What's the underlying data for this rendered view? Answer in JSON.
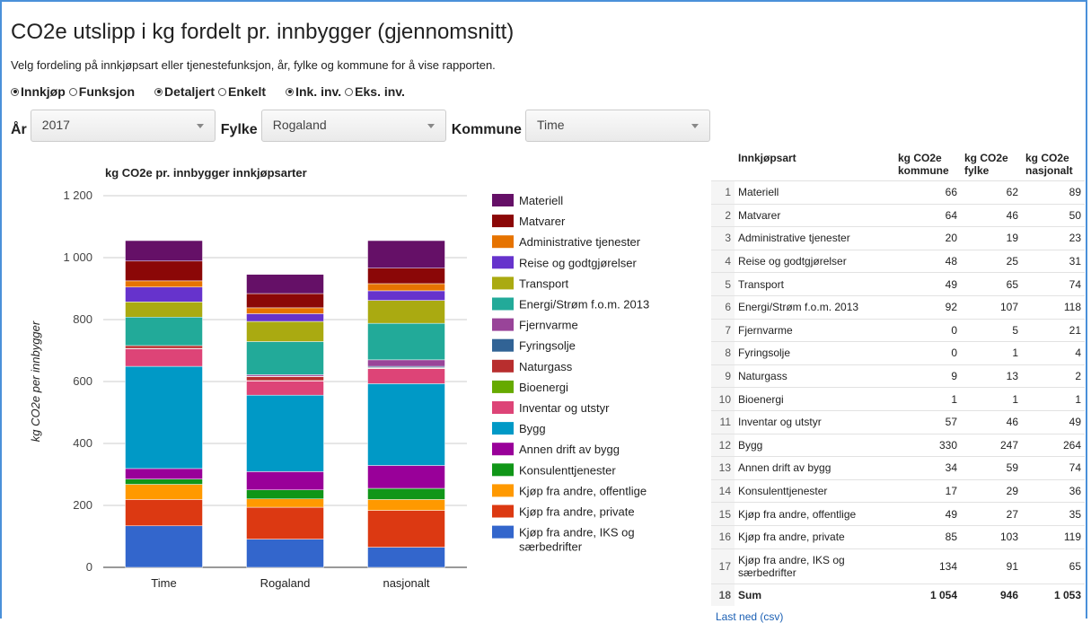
{
  "header": {
    "title": "CO2e utslipp i kg fordelt pr. innbygger (gjennomsnitt)",
    "subtitle": "Velg fordeling på innkjøpsart eller tjenestefunksjon, år, fylke og kommune for å vise rapporten."
  },
  "radios": {
    "group1": [
      {
        "label": "Innkjøp",
        "checked": true
      },
      {
        "label": "Funksjon",
        "checked": false
      }
    ],
    "group2": [
      {
        "label": "Detaljert",
        "checked": true
      },
      {
        "label": "Enkelt",
        "checked": false
      }
    ],
    "group3": [
      {
        "label": "Ink. inv.",
        "checked": true
      },
      {
        "label": "Eks. inv.",
        "checked": false
      }
    ]
  },
  "filters": {
    "year_label": "År",
    "year_value": "2017",
    "county_label": "Fylke",
    "county_value": "Rogaland",
    "municipality_label": "Kommune",
    "municipality_value": "Time"
  },
  "chart_data": {
    "type": "bar",
    "stacked": true,
    "title": "kg CO2e pr. innbygger innkjøpsarter",
    "ylabel": "kg CO2e per innbygger",
    "xlabel": "",
    "ylim": [
      0,
      1200
    ],
    "yticks": [
      "0",
      "200",
      "400",
      "600",
      "800",
      "1 000",
      "1 200"
    ],
    "categories": [
      "Time",
      "Rogaland",
      "nasjonalt"
    ],
    "legend_position": "right",
    "series": [
      {
        "name": "Kjøp fra andre, IKS og særbedrifter",
        "color": "#3366cc",
        "values": [
          134,
          91,
          65
        ]
      },
      {
        "name": "Kjøp fra andre, private",
        "color": "#dc3912",
        "values": [
          85,
          103,
          119
        ]
      },
      {
        "name": "Kjøp fra andre, offentlige",
        "color": "#ff9900",
        "values": [
          49,
          27,
          35
        ]
      },
      {
        "name": "Konsulenttjenester",
        "color": "#109618",
        "values": [
          17,
          29,
          36
        ]
      },
      {
        "name": "Annen drift av bygg",
        "color": "#990099",
        "values": [
          34,
          59,
          74
        ]
      },
      {
        "name": "Bygg",
        "color": "#0099c6",
        "values": [
          330,
          247,
          264
        ]
      },
      {
        "name": "Inventar og utstyr",
        "color": "#dd4477",
        "values": [
          57,
          46,
          49
        ]
      },
      {
        "name": "Bioenergi",
        "color": "#66aa00",
        "values": [
          1,
          1,
          1
        ]
      },
      {
        "name": "Naturgass",
        "color": "#b82e2e",
        "values": [
          9,
          13,
          2
        ]
      },
      {
        "name": "Fyringsolje",
        "color": "#316395",
        "values": [
          0,
          1,
          4
        ]
      },
      {
        "name": "Fjernvarme",
        "color": "#994499",
        "values": [
          0,
          5,
          21
        ]
      },
      {
        "name": "Energi/Strøm f.o.m. 2013",
        "color": "#22aa99",
        "values": [
          92,
          107,
          118
        ]
      },
      {
        "name": "Transport",
        "color": "#aaaa11",
        "values": [
          49,
          65,
          74
        ]
      },
      {
        "name": "Reise og godtgjørelser",
        "color": "#6633cc",
        "values": [
          48,
          25,
          31
        ]
      },
      {
        "name": "Administrative tjenester",
        "color": "#e67300",
        "values": [
          20,
          19,
          23
        ]
      },
      {
        "name": "Matvarer",
        "color": "#8b0707",
        "values": [
          64,
          46,
          50
        ]
      },
      {
        "name": "Materiell",
        "color": "#651067",
        "values": [
          66,
          62,
          89
        ]
      }
    ]
  },
  "table": {
    "headers": [
      "",
      "Innkjøpsart",
      "kg CO2e kommune",
      "kg CO2e fylke",
      "kg CO2e nasjonalt"
    ],
    "rows": [
      [
        "1",
        "Materiell",
        "66",
        "62",
        "89"
      ],
      [
        "2",
        "Matvarer",
        "64",
        "46",
        "50"
      ],
      [
        "3",
        "Administrative tjenester",
        "20",
        "19",
        "23"
      ],
      [
        "4",
        "Reise og godtgjørelser",
        "48",
        "25",
        "31"
      ],
      [
        "5",
        "Transport",
        "49",
        "65",
        "74"
      ],
      [
        "6",
        "Energi/Strøm f.o.m. 2013",
        "92",
        "107",
        "118"
      ],
      [
        "7",
        "Fjernvarme",
        "0",
        "5",
        "21"
      ],
      [
        "8",
        "Fyringsolje",
        "0",
        "1",
        "4"
      ],
      [
        "9",
        "Naturgass",
        "9",
        "13",
        "2"
      ],
      [
        "10",
        "Bioenergi",
        "1",
        "1",
        "1"
      ],
      [
        "11",
        "Inventar og utstyr",
        "57",
        "46",
        "49"
      ],
      [
        "12",
        "Bygg",
        "330",
        "247",
        "264"
      ],
      [
        "13",
        "Annen drift av bygg",
        "34",
        "59",
        "74"
      ],
      [
        "14",
        "Konsulenttjenester",
        "17",
        "29",
        "36"
      ],
      [
        "15",
        "Kjøp fra andre, offentlige",
        "49",
        "27",
        "35"
      ],
      [
        "16",
        "Kjøp fra andre, private",
        "85",
        "103",
        "119"
      ],
      [
        "17",
        "Kjøp fra andre, IKS og særbedrifter",
        "134",
        "91",
        "65"
      ],
      [
        "18",
        "Sum",
        "1 054",
        "946",
        "1 053"
      ]
    ]
  },
  "footer": {
    "link": "Last ned (csv)"
  }
}
